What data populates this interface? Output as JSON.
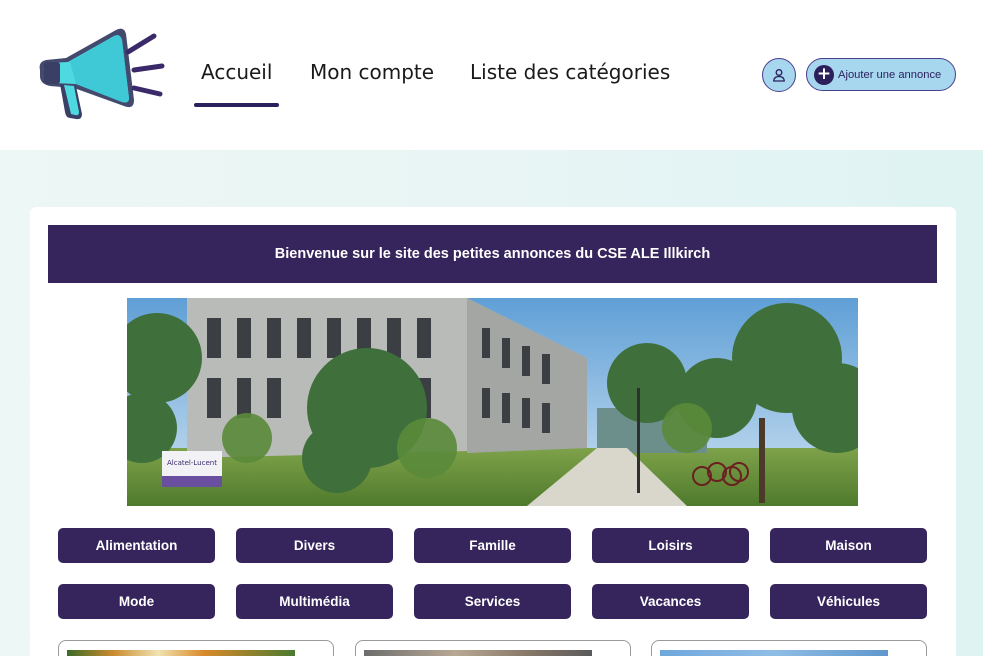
{
  "nav": {
    "items": [
      {
        "label": "Accueil",
        "active": true
      },
      {
        "label": "Mon compte",
        "active": false
      },
      {
        "label": "Liste des catégories",
        "active": false
      }
    ]
  },
  "header": {
    "user_icon": "user-icon",
    "add_button_label": "Ajouter une annonce",
    "add_icon": "plus-circle-icon"
  },
  "banner": {
    "title": "Bienvenue sur le site des petites annonces du CSE ALE Illkirch"
  },
  "photo": {
    "sign_text": "Alcatel-Lucent"
  },
  "categories": [
    "Alimentation",
    "Divers",
    "Famille",
    "Loisirs",
    "Maison",
    "Mode",
    "Multimédia",
    "Services",
    "Vacances",
    "Véhicules"
  ],
  "colors": {
    "primary": "#36245c",
    "accent": "#a7d6ef",
    "logo_cyan": "#4ed8e0"
  }
}
